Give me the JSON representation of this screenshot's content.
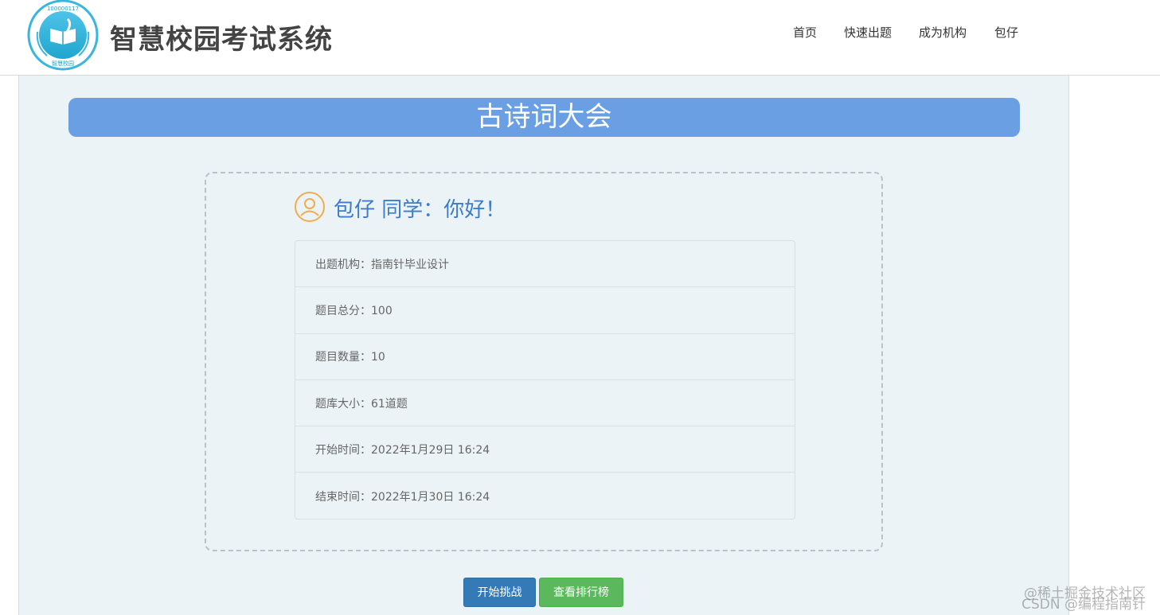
{
  "header": {
    "logo_ring_text": "100000117",
    "logo_bottom_text": "智慧校园",
    "title": "智慧校园考试系统",
    "nav": [
      "首页",
      "快速出题",
      "成为机构",
      "包仔"
    ]
  },
  "exam": {
    "banner_title": "古诗词大会",
    "greeting": "包仔 同学：你好！",
    "info": [
      "出题机构：指南针毕业设计",
      "题目总分：100",
      "题目数量：10",
      "题库大小：61道题",
      "开始时间：2022年1月29日 16:24",
      "结束时间：2022年1月30日 16:24"
    ],
    "buttons": {
      "start": "开始挑战",
      "ranking": "查看排行榜"
    }
  },
  "watermark": {
    "line1": "@稀土掘金技术社区",
    "line2": "CSDN @编程指南针"
  },
  "colors": {
    "banner": "#6a9fe4",
    "greeting": "#3d7cc9",
    "start_button": "#337ab7",
    "ranking_button": "#5cb85c",
    "background": "#ebf3f6"
  }
}
